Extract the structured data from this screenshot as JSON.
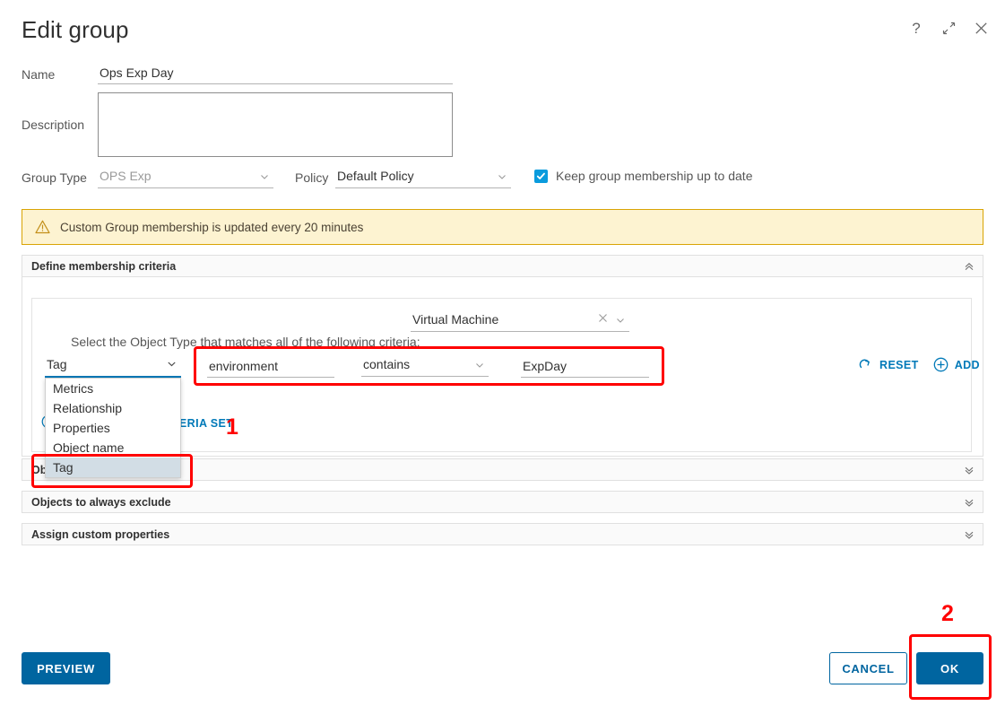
{
  "header": {
    "title": "Edit group",
    "icons": [
      {
        "name": "help-icon",
        "glyph": "?"
      },
      {
        "name": "expand-icon",
        "glyph": "⤢"
      },
      {
        "name": "close-icon",
        "glyph": "✕"
      }
    ]
  },
  "form": {
    "name_label": "Name",
    "name_value": "Ops Exp Day",
    "name_placeholder": "",
    "description_label": "Description",
    "description_value": "",
    "description_placeholder": "",
    "group_type_label": "Group Type",
    "group_type_value": "OPS Exp",
    "policy_label": "Policy",
    "policy_value": "Default Policy",
    "keep_membership_label": "Keep group membership up to date",
    "keep_membership_checked": true
  },
  "warning": {
    "icon": "warning-triangle-icon",
    "text": "Custom Group membership is updated every 20 minutes"
  },
  "panels": {
    "define": {
      "title": "Define membership criteria",
      "expanded": true,
      "chevron": "double-chevron-up-icon"
    },
    "include": {
      "title": "Objects to always include",
      "expanded": false,
      "chevron": "double-chevron-down-icon"
    },
    "exclude": {
      "title": "Objects to always exclude",
      "expanded": false,
      "chevron": "double-chevron-down-icon"
    },
    "custom_properties": {
      "title": "Assign custom properties",
      "expanded": false,
      "chevron": "double-chevron-down-icon"
    }
  },
  "criteria": {
    "prompt": "Select the Object Type that matches all of the following criteria:",
    "object_type_value": "Virtual Machine",
    "criteria_type_value": "Tag",
    "criteria_type_options": [
      "Metrics",
      "Relationship",
      "Properties",
      "Object name",
      "Tag"
    ],
    "criteria_type_selected": "Tag",
    "key_value": "environment",
    "key_placeholder": "",
    "operator_value": "contains",
    "value_value": "ExpDay",
    "value_placeholder": "",
    "reset_label": "RESET",
    "add_label": "ADD",
    "add_set_label": "ADD ANOTHER CRITERIA SET"
  },
  "footer": {
    "preview_label": "PREVIEW",
    "cancel_label": "CANCEL",
    "ok_label": "OK"
  },
  "annotations": {
    "num1": "1",
    "num2": "2"
  },
  "colors": {
    "accent_blue": "#0079b8",
    "button_blue": "#0065a0",
    "checkbox_blue": "#0a9bdd",
    "warning_bg": "#fdf3d1",
    "warning_border": "#d9a404",
    "annotation_red": "#ff0000"
  }
}
